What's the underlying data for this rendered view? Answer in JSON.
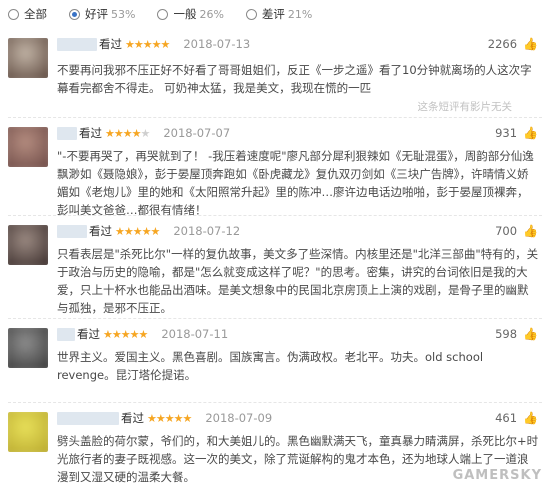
{
  "filters": [
    {
      "label": "全部",
      "pct": "",
      "checked": false
    },
    {
      "label": "好评",
      "pct": "53%",
      "checked": true
    },
    {
      "label": "一般",
      "pct": "26%",
      "checked": false
    },
    {
      "label": "差评",
      "pct": "21%",
      "checked": false
    }
  ],
  "comments": [
    {
      "rating_label": "看过",
      "stars": 5,
      "date": "2018-07-13",
      "votes": "2266",
      "text": "不要再问我邪不压正好不好看了哥哥姐姐们，反正《一步之遥》看了10分钟就离场的人这次字幕看完都舍不得走。 可奶神太猛，我是美文，我现在慌的一匹",
      "hint": "这条短评有影片无关",
      "avatar_colors": [
        "#c2b4a6",
        "#5e4a40"
      ],
      "name_width": 40
    },
    {
      "rating_label": "看过",
      "stars": 4,
      "date": "2018-07-07",
      "votes": "931",
      "text": "\"-不要再哭了，再哭就到了！ -我压着速度呢\"廖凡部分犀利狠辣如《无耻混蛋》，周韵部分仙逸飘渺如《聂隐娘》，彭于晏屋顶奔跑如《卧虎藏龙》复仇双刃剑如《三块广告牌》，许晴情义娇媚如《老炮儿》里的她和《太阳照常升起》里的陈冲…廖许边电话边啪啪，彭于晏屋顶裸奔，彭叫美文爸爸…都很有情绪！",
      "hint": "",
      "avatar_colors": [
        "#b58d80",
        "#6e4b47"
      ],
      "name_width": 20
    },
    {
      "rating_label": "看过",
      "stars": 5,
      "date": "2018-07-12",
      "votes": "700",
      "text": "只看表层是\"杀死比尔\"一样的复仇故事，美文多了些深情。内核里还是\"北洋三部曲\"特有的，关于政治与历史的隐喻，都是\"怎么就变成这样了呢？\"的思考。密集，讲究的台词依旧是我的大爱，只上十杯水也能品出酒味。是美文想象中的民国北京房顶上上演的戏剧，是骨子里的幽默与孤独，是邪不压正。",
      "hint": "",
      "avatar_colors": [
        "#9c8b83",
        "#3b2e2c"
      ],
      "name_width": 30
    },
    {
      "rating_label": "看过",
      "stars": 5,
      "date": "2018-07-11",
      "votes": "598",
      "text": "世界主义。爱国主义。黑色喜剧。国族寓言。伪满政权。老北平。功夫。old school revenge。昆汀塔伦提诺。",
      "hint": "",
      "avatar_colors": [
        "#8e8e8e",
        "#3a3a3a"
      ],
      "name_width": 18
    },
    {
      "rating_label": "看过",
      "stars": 5,
      "date": "2018-07-09",
      "votes": "461",
      "text": "劈头盖脸的荷尔蒙，爷们的，和大美姐儿的。黑色幽默满天飞，童真暴力睛满屏，杀死比尔+时光旅行者的妻子既视感。这一次的美文，除了荒诞解构的鬼才本色，还为地球人端上了一道浪漫到又湿又硬的温柔大餐。",
      "hint": "",
      "avatar_colors": [
        "#e8e05a",
        "#b9a92e"
      ],
      "name_width": 62
    }
  ],
  "watermark": "GAMERSKY"
}
